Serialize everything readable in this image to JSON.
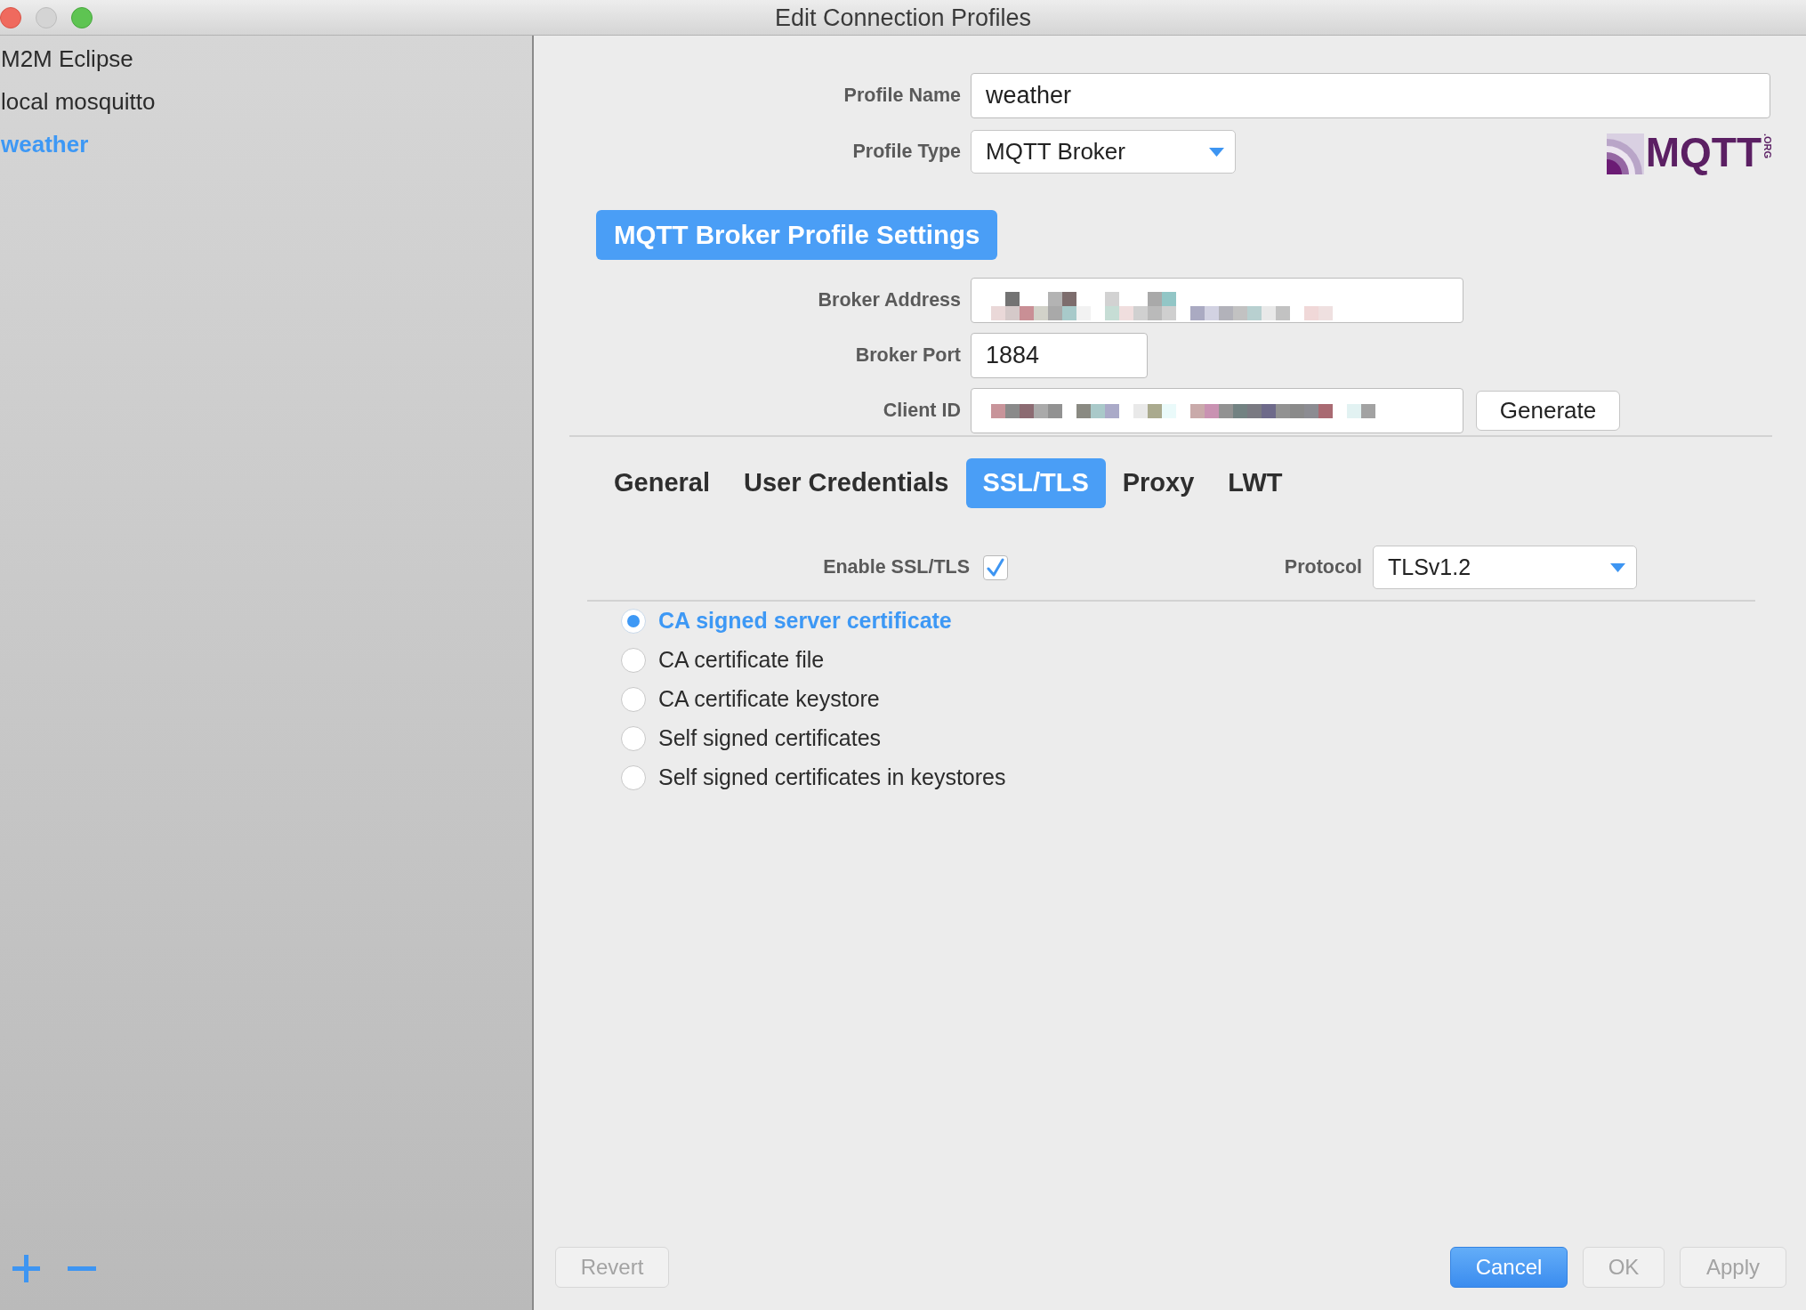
{
  "window": {
    "title": "Edit Connection Profiles",
    "buttons": [
      {
        "kind": "close",
        "disabled": false
      },
      {
        "kind": "minimize",
        "disabled": true
      },
      {
        "kind": "zoom",
        "disabled": false
      }
    ]
  },
  "sidebar": {
    "items": [
      {
        "label": "M2M Eclipse",
        "selected": false
      },
      {
        "label": "local mosquitto",
        "selected": false
      },
      {
        "label": "weather",
        "selected": true
      }
    ],
    "actions": [
      {
        "kind": "add"
      },
      {
        "kind": "remove"
      }
    ]
  },
  "profile": {
    "name_label": "Profile Name",
    "name": "weather",
    "type_label": "Profile Type",
    "type": "MQTT Broker"
  },
  "logo": {
    "wordmark": "MQTT",
    "suffix": ".ORG"
  },
  "section_heading": "MQTT Broker Profile Settings",
  "broker": {
    "fields": [
      {
        "label": "Broker Address",
        "kind": "obscured"
      },
      {
        "label": "Broker Port",
        "kind": "text",
        "value": "1884"
      },
      {
        "label": "Client ID",
        "kind": "obscured",
        "button": "Generate"
      }
    ]
  },
  "tabs": [
    {
      "label": "General",
      "selected": false
    },
    {
      "label": "User Credentials",
      "selected": false
    },
    {
      "label": "SSL/TLS",
      "selected": true
    },
    {
      "label": "Proxy",
      "selected": false
    },
    {
      "label": "LWT",
      "selected": false
    }
  ],
  "ssl": {
    "enable_label": "Enable SSL/TLS",
    "checked": true,
    "protocol_label": "Protocol",
    "protocol": "TLSv1.2",
    "options": [
      {
        "label": "CA signed server certificate",
        "selected": true
      },
      {
        "label": "CA certificate file",
        "selected": false
      },
      {
        "label": "CA certificate keystore",
        "selected": false
      },
      {
        "label": "Self signed certificates",
        "selected": false
      },
      {
        "label": "Self signed certificates in keystores",
        "selected": false
      }
    ]
  },
  "footer": {
    "left_buttons": [
      {
        "label": "Revert",
        "disabled": true,
        "default": false
      }
    ],
    "right_buttons": [
      {
        "label": "Cancel",
        "disabled": false,
        "default": true
      },
      {
        "label": "OK",
        "disabled": true,
        "default": false
      },
      {
        "label": "Apply",
        "disabled": true,
        "default": false
      }
    ]
  }
}
